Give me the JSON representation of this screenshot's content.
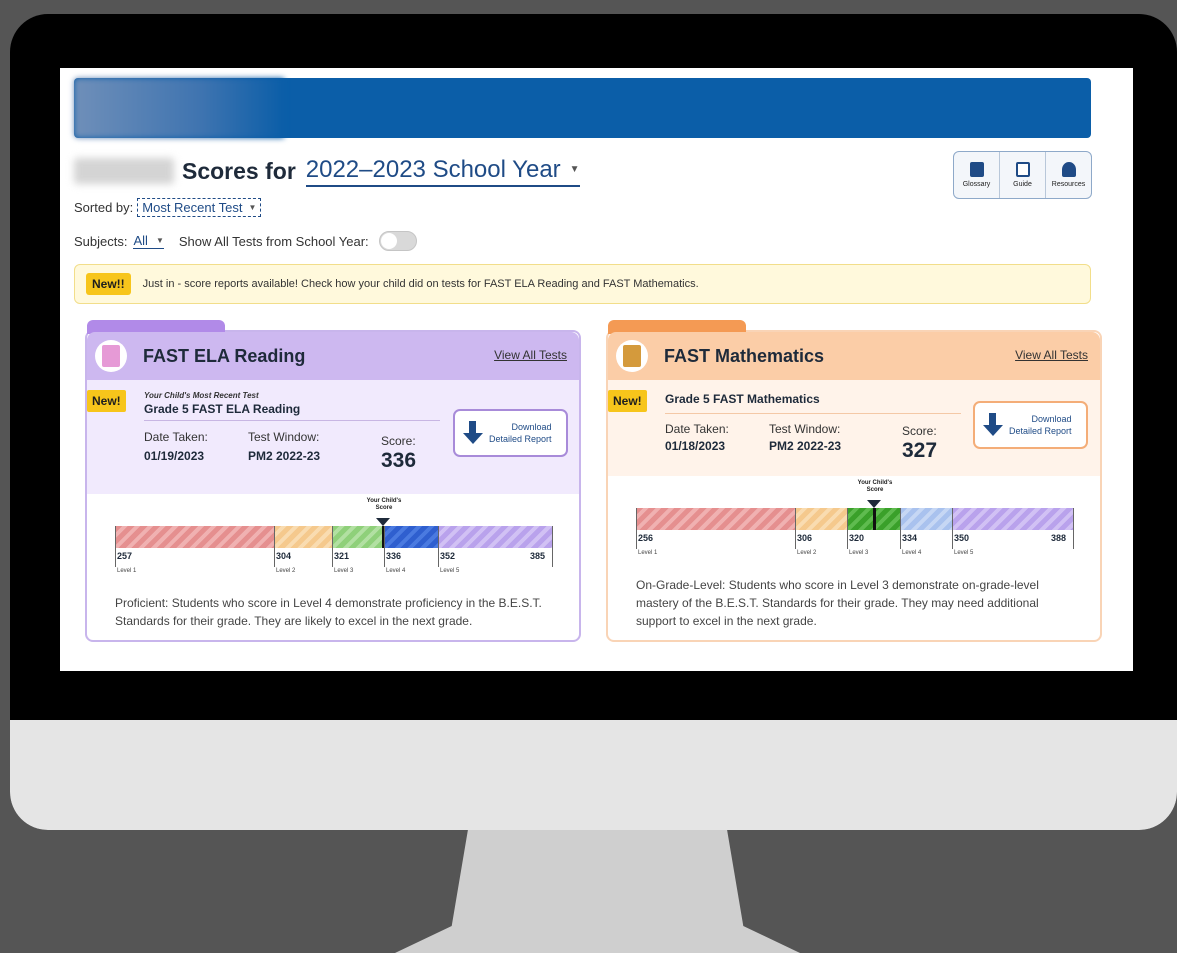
{
  "header": {
    "title": "Scores for",
    "school_year": "2022–2023 School Year"
  },
  "toolbar": {
    "glossary_label": "Glossary",
    "guide_label": "Guide",
    "resources_label": "Resources"
  },
  "sort": {
    "label": "Sorted by:",
    "value": "Most Recent Test"
  },
  "filters": {
    "subjects_label": "Subjects:",
    "subjects_value": "All",
    "show_all_label": "Show All Tests from School Year:",
    "show_all_on": false
  },
  "alert": {
    "badge": "New!!",
    "text": "Just in - score reports available! Check how your child did on tests for FAST ELA Reading and FAST Mathematics."
  },
  "cards": [
    {
      "title": "FAST ELA Reading",
      "view_all": "View All Tests",
      "badge": "New!",
      "recent_label": "Your Child's Most Recent Test",
      "test_name": "Grade 5 FAST ELA Reading",
      "date_label": "Date Taken:",
      "date": "01/19/2023",
      "window_label": "Test Window:",
      "window": "PM2 2022-23",
      "score_label": "Score:",
      "score": "336",
      "download_label_1": "Download",
      "download_label_2": "Detailed Report",
      "your_score_label_1": "Your Child's",
      "your_score_label_2": "Score",
      "levels": [
        {
          "start": "257",
          "name": "Level 1",
          "color": "#e58f8f"
        },
        {
          "start": "304",
          "name": "Level 2",
          "color": "#f5c98d"
        },
        {
          "start": "321",
          "name": "Level 3",
          "color": "#8fd07a"
        },
        {
          "start": "336",
          "name": "Level 4",
          "color": "#2f5fcf"
        },
        {
          "start": "352",
          "name": "Level 5",
          "color": "#b9a2ec"
        }
      ],
      "max": "385",
      "description": "Proficient: Students who score in Level 4 demonstrate proficiency in the B.E.S.T. Standards for their grade. They are likely to excel in the next grade."
    },
    {
      "title": "FAST Mathematics",
      "view_all": "View All Tests",
      "badge": "New!",
      "test_name": "Grade 5 FAST Mathematics",
      "date_label": "Date Taken:",
      "date": "01/18/2023",
      "window_label": "Test Window:",
      "window": "PM2 2022-23",
      "score_label": "Score:",
      "score": "327",
      "download_label_1": "Download",
      "download_label_2": "Detailed Report",
      "your_score_label_1": "Your Child's",
      "your_score_label_2": "Score",
      "levels": [
        {
          "start": "256",
          "name": "Level 1",
          "color": "#e58f8f"
        },
        {
          "start": "306",
          "name": "Level 2",
          "color": "#f5c98d"
        },
        {
          "start": "320",
          "name": "Level 3",
          "color": "#3aa02a"
        },
        {
          "start": "334",
          "name": "Level 4",
          "color": "#a9c2ee"
        },
        {
          "start": "350",
          "name": "Level 5",
          "color": "#b9a2ec"
        }
      ],
      "max": "388",
      "description": "On-Grade-Level: Students who score in Level 3 demonstrate on-grade-level mastery of the B.E.S.T. Standards for their grade. They may need additional support to excel in the next grade."
    }
  ]
}
